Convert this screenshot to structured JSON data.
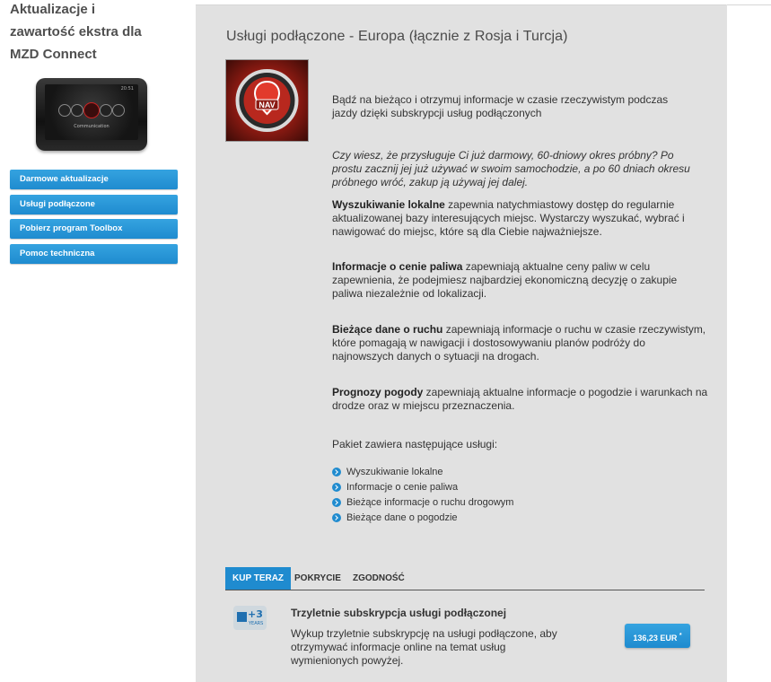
{
  "sidebar": {
    "title": "Aktualizacje i\nzawartość ekstra dla\nMZD Connect",
    "device": {
      "time": "20:51",
      "caption": "Communication"
    },
    "nav": [
      {
        "label": "Darmowe aktualizacje"
      },
      {
        "label": "Usługi podłączone"
      },
      {
        "label": "Pobierz program Toolbox"
      },
      {
        "label": "Pomoc techniczna"
      }
    ]
  },
  "main": {
    "title": "Usługi podłączone - Europa (łącznie z Rosja i Turcja)",
    "image_badge": "NAV",
    "intro": "Bądź na bieżąco i otrzymuj informacje w czasie rzeczywistym podczas jazdy dzięki subskrypcji usług podłączonych",
    "trial_note": "Czy wiesz, że przysługuje Ci już darmowy, 60-dniowy okres próbny? Po prostu zacznij jej już używać w swoim samochodzie, a po 60 dniach okresu próbnego wróć, zakup ją używaj jej dalej.",
    "features": [
      {
        "title": "Wyszukiwanie lokalne",
        "text": " zapewnia natychmiastowy dostęp do regularnie aktualizowanej bazy interesujących miejsc. Wystarczy wyszukać, wybrać i nawigować do miejsc, które są dla Ciebie najważniejsze."
      },
      {
        "title": "Informacje o cenie paliwa",
        "text": " zapewniają aktualne ceny paliw w celu zapewnienia, że podejmiesz najbardziej ekonomiczną decyzję o zakupie paliwa niezależnie od lokalizacji."
      },
      {
        "title": "Bieżące dane o ruchu",
        "text": " zapewniają informacje o ruchu w czasie rzeczywistym, które pomagają w nawigacji i dostosowywaniu planów podróży do najnowszych danych o sytuacji na drogach."
      },
      {
        "title": "Prognozy pogody",
        "text": " zapewniają aktualne informacje o pogodzie i warunkach na drodze oraz w miejscu przeznaczenia."
      }
    ],
    "package_intro": "Pakiet zawiera następujące usługi:",
    "package_items": [
      "Wyszukiwanie lokalne",
      "Informacje o cenie paliwa",
      "Bieżące informacje o ruchu drogowym",
      "Bieżące dane o pogodzie"
    ],
    "tabs": [
      {
        "label": "KUP TERAZ",
        "active": true
      },
      {
        "label": "POKRYCIE"
      },
      {
        "label": "ZGODNOŚĆ"
      }
    ],
    "offer": {
      "icon": {
        "plus": "+3",
        "years": "YEARS"
      },
      "title": "Trzyletnie subskrypcja usługi podłączonej",
      "description": "Wykup trzyletnie subskrypcję na usługi podłączone, aby otrzymywać informacje online na temat usług wymienionych powyżej.",
      "price": "136,23 EUR",
      "price_mark": "*"
    }
  },
  "colors": {
    "accent": "#1f8bcf",
    "panel": "#e1e1e1",
    "nav_image": "#b8281e"
  }
}
